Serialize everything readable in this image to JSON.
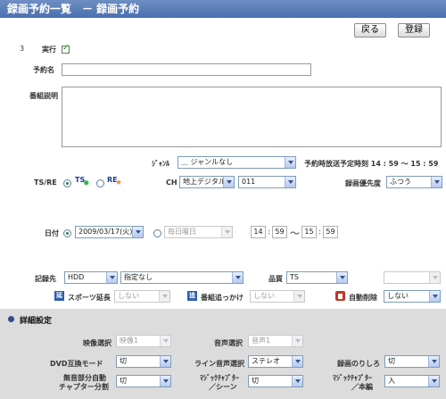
{
  "header": {
    "title": "録画予約一覧　－ 録画予約"
  },
  "toolbar": {
    "back_label": "戻る",
    "register_label": "登録"
  },
  "form": {
    "number": "3",
    "execute_label": "実行",
    "name_label": "予約名",
    "name_value": "",
    "description_label": "番組説明",
    "description_value": ""
  },
  "genre": {
    "label": "ｼﾞｬﾝﾙ",
    "value": "＿ ジャンルなし"
  },
  "schedule_note": "予約時放送予定時刻 14 : 59 ～ 15 : 59",
  "ts_re": {
    "label": "TS/RE",
    "ts_icon_text": "TS",
    "re_icon_text": "RE"
  },
  "channel": {
    "label": "CH",
    "type_value": "地上デジタル",
    "number_value": "011"
  },
  "priority": {
    "label": "録画優先度",
    "value": "ふつう"
  },
  "date": {
    "label": "日付",
    "date_value": "2009/03/17(火)",
    "weekday_value": "毎日曜日",
    "start_hour": "14",
    "start_min": "59",
    "tilde": "～",
    "end_hour": "15",
    "end_min": "59",
    "colon": ":"
  },
  "record_to": {
    "label": "記録先",
    "dest_value": "HDD",
    "folder_value": "指定なし"
  },
  "quality": {
    "label": "品質",
    "value": "TS",
    "extra_value": ""
  },
  "options": {
    "sports_icon": "延",
    "sports_label": "スポーツ延長",
    "sports_value": "しない",
    "chase_icon": "追",
    "chase_label": "番組追っかけ",
    "chase_value": "しない",
    "auto_delete_label": "自動削除",
    "auto_delete_value": "しない"
  },
  "details": {
    "title": "詳細設定",
    "video_label": "映像選択",
    "video_value": "映像1",
    "audio_label": "音声選択",
    "audio_value": "音声1",
    "dvd_label": "DVD互換モード",
    "dvd_value": "切",
    "line_audio_label": "ライン音声選択",
    "line_audio_value": "ステレオ",
    "remainder_label": "録画のりしろ",
    "remainder_value": "切",
    "silent_label_1": "無音部分自動",
    "silent_label_2": "チャプター分割",
    "silent_value": "切",
    "magic_scene_label_1": "ﾏｼﾞｯｸﾁｬﾌﾟﾀｰ",
    "magic_scene_label_2": "／シーン",
    "magic_scene_value": "切",
    "magic_main_label_1": "ﾏｼﾞｯｸﾁｬﾌﾟﾀｰ",
    "magic_main_label_2": "／本編",
    "magic_main_value": "入"
  }
}
